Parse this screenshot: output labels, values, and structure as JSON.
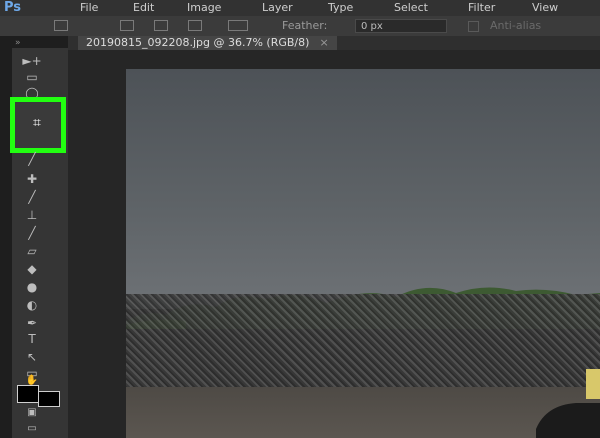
{
  "app": {
    "logo": "Ps"
  },
  "menu": [
    "File",
    "Edit",
    "Image",
    "Layer",
    "Type",
    "Select",
    "Filter",
    "View"
  ],
  "options": {
    "feather_label": "Feather:",
    "feather_value": "0 px",
    "antialias_label": "Anti-alias"
  },
  "document_tab": {
    "title": "20190815_092208.jpg @ 36.7% (RGB/8)",
    "close": "×"
  },
  "tools": {
    "type_tool": "T"
  },
  "colors": {
    "highlight": "#22ff11",
    "foreground": "#000000",
    "background": "#000000"
  }
}
